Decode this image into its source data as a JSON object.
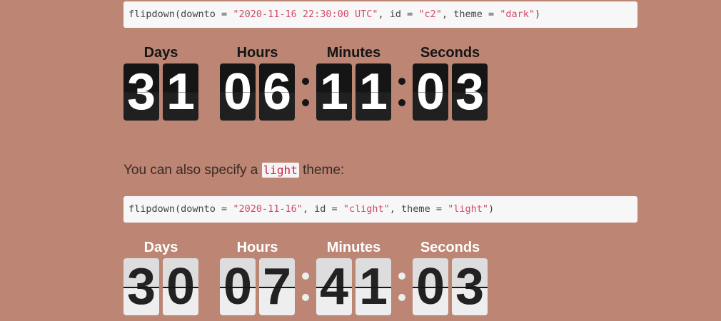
{
  "code_dark": {
    "prefix": "flipdown(downto = ",
    "downto": "\"2020-11-16 22:30:00 UTC\"",
    "mid1": ", id = ",
    "id": "\"c2\"",
    "mid2": ", theme = ",
    "theme": "\"dark\"",
    "suffix": ")"
  },
  "prose": {
    "before": "You can also specify a ",
    "code": "light",
    "after": " theme:"
  },
  "code_light": {
    "prefix": "flipdown(downto = ",
    "downto": "\"2020-11-16\"",
    "mid1": ", id = ",
    "id": "\"clight\"",
    "mid2": ", theme = ",
    "theme": "\"light\"",
    "suffix": ")"
  },
  "countdown_dark": {
    "theme": "dark",
    "headings": {
      "days": "Days",
      "hours": "Hours",
      "minutes": "Minutes",
      "seconds": "Seconds"
    },
    "days": [
      "3",
      "1"
    ],
    "hours": [
      "0",
      "6"
    ],
    "minutes": [
      "1",
      "1"
    ],
    "seconds": [
      "0",
      "3"
    ]
  },
  "countdown_light": {
    "theme": "light",
    "headings": {
      "days": "Days",
      "hours": "Hours",
      "minutes": "Minutes",
      "seconds": "Seconds"
    },
    "days": [
      "3",
      "0"
    ],
    "hours": [
      "0",
      "7"
    ],
    "minutes": [
      "4",
      "1"
    ],
    "seconds": [
      "0",
      "3"
    ]
  },
  "colors": {
    "page_background": "#bc8574",
    "code_background": "#f7f7f7",
    "code_string": "#d14b6a",
    "dark_rotor": "#151515",
    "light_rotor": "#eeeeee"
  }
}
